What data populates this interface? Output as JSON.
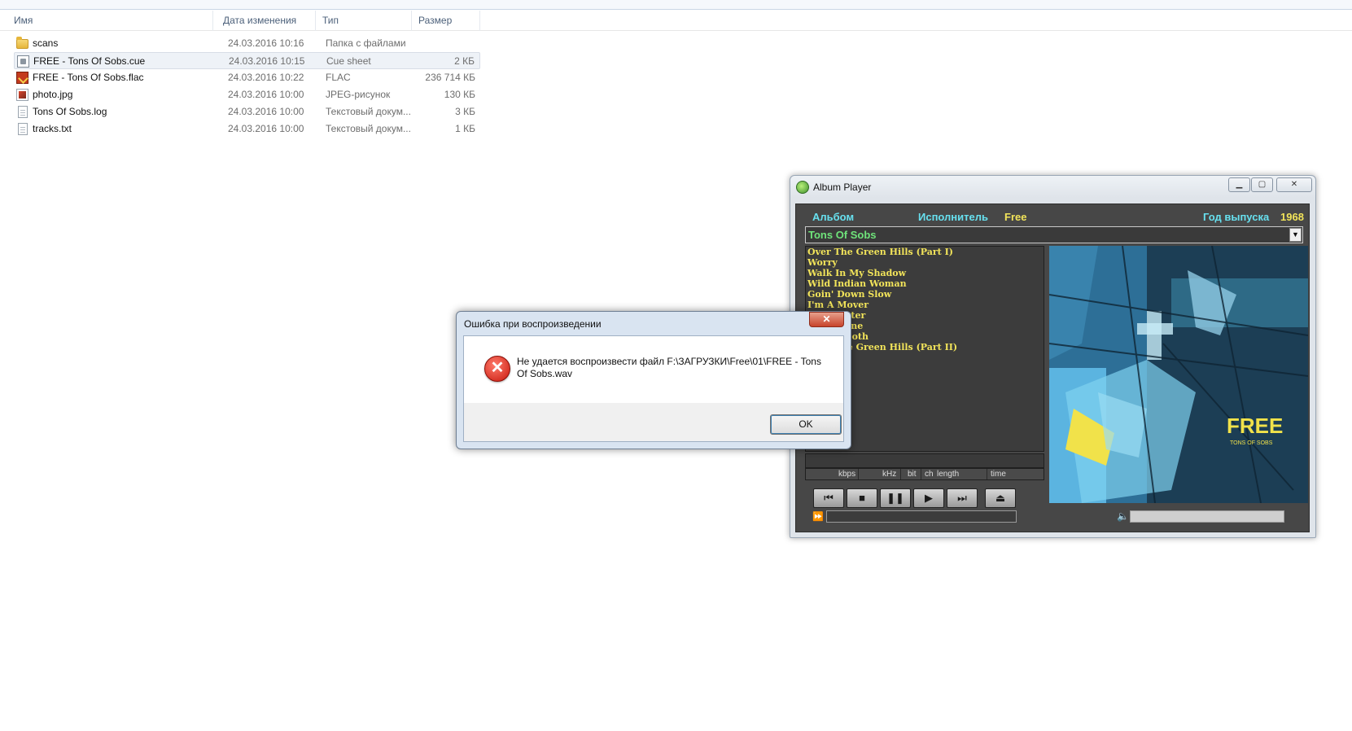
{
  "explorer": {
    "columns": {
      "name": "Имя",
      "date": "Дата изменения",
      "type": "Тип",
      "size": "Размер"
    },
    "files": [
      {
        "name": "scans",
        "date": "24.03.2016 10:16",
        "type": "Папка с файлами",
        "size": "",
        "icon": "folder-icon"
      },
      {
        "name": "FREE - Tons Of Sobs.cue",
        "date": "24.03.2016 10:15",
        "type": "Cue sheet",
        "size": "2 КБ",
        "icon": "cue-file-icon"
      },
      {
        "name": "FREE - Tons Of Sobs.flac",
        "date": "24.03.2016 10:22",
        "type": "FLAC",
        "size": "236 714 КБ",
        "icon": "flac-file-icon"
      },
      {
        "name": "photo.jpg",
        "date": "24.03.2016 10:00",
        "type": "JPEG-рисунок",
        "size": "130 КБ",
        "icon": "image-file-icon"
      },
      {
        "name": "Tons Of Sobs.log",
        "date": "24.03.2016 10:00",
        "type": "Текстовый докум...",
        "size": "3 КБ",
        "icon": "text-file-icon"
      },
      {
        "name": "tracks.txt",
        "date": "24.03.2016 10:00",
        "type": "Текстовый докум...",
        "size": "1 КБ",
        "icon": "text-file-icon"
      }
    ]
  },
  "player": {
    "window_title": "Album Player",
    "labels": {
      "album": "Альбом",
      "artist": "Исполнитель",
      "year": "Год выпуска"
    },
    "artist": "Free",
    "year": "1968",
    "album_selected": "Tons Of Sobs",
    "tracks": [
      "Over The Green Hills (Part I)",
      "Worry",
      "Walk In My Shadow",
      "Wild Indian Woman",
      "Goin' Down Slow",
      "I'm A Mover",
      "The Hunter",
      "Moonshine",
      "Sweet Tooth",
      "Over The Green Hills (Part II)"
    ],
    "info_labels": {
      "kbps": "kbps",
      "khz": "kHz",
      "bit": "bit",
      "ch": "ch",
      "length": "length",
      "time": "time"
    },
    "controls": {
      "prev": "⏮",
      "stop": "■",
      "pause": "❚❚",
      "play": "▶",
      "next": "⏭",
      "eject": "⏏"
    },
    "seek_icon": "⏩",
    "volume_icon": "🔈",
    "cover": {
      "brand": "FREE",
      "subtitle": "TONS OF SOBS"
    }
  },
  "dialog": {
    "title": "Ошибка при воспроизведении",
    "close": "✕",
    "message": "Не удается воспроизвести файл  F:\\ЗАГРУЗКИ\\Free\\01\\FREE - Tons Of Sobs.wav",
    "ok": "OK",
    "icon_glyph": "✕"
  }
}
